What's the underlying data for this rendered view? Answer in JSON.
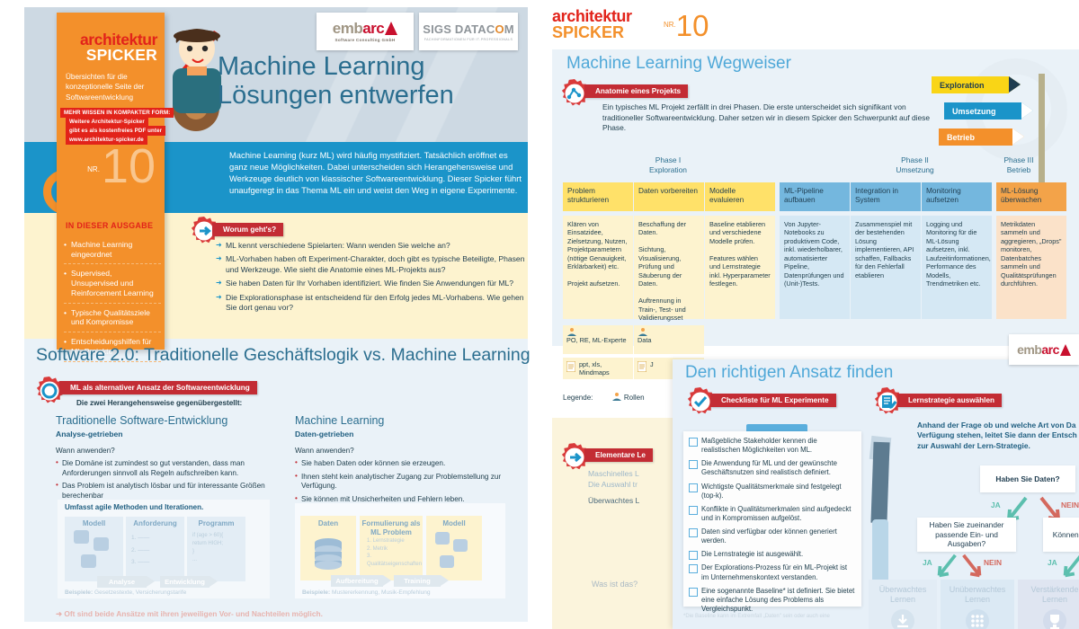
{
  "left_page": {
    "logos": [
      {
        "name": "embarc",
        "word_a": "emb",
        "word_b": "arc",
        "sub": "Software Consulting GmbH"
      },
      {
        "name": "sigs-datacom",
        "word": "SIGS DATAC",
        "word_o": "O",
        "word_end": "M",
        "sub": "FACHINFORMATIONEN FÜR IT-PROFESSIONALS"
      }
    ],
    "sidebar": {
      "brand_line1": "architektur",
      "brand_line2": "SPICKER",
      "tagline": "Übersichten für die konzeptionelle Seite der Softwareentwicklung",
      "red_bars": [
        "MEHR WISSEN IN KOMPAKTER FORM:",
        "Weitere Architektur-Spicker",
        "gibt es als kostenfreies PDF unter",
        "www.architektur-spicker.de"
      ],
      "nr_label": "NR.",
      "nr_value": "10",
      "issue_heading": "IN DIESER AUSGABE",
      "issue_items": [
        "Machine Learning eingeordnet",
        "Supervised, Unsupervised und Reinforcement Learning",
        "Typische Qualitätsziele und Kompromisse",
        "Entscheidungshilfen für ML-Projekte"
      ]
    },
    "title_line1": "Machine Learning",
    "title_line2": "Lösungen entwerfen",
    "intro": "Machine Learning (kurz ML) wird häufig mystifiziert. Tatsächlich eröffnet es ganz neue Möglichkeiten. Dabei unterscheiden sich Herangehensweise und Werkzeuge deutlich von klassischer Softwareentwicklung. Dieser Spicker führt unaufgeregt in das Thema ML ein und weist den Weg in eigene Experimente.",
    "worum": {
      "ribbon": "Worum geht's?",
      "items": [
        "ML kennt verschiedene Spielarten:  Wann wenden Sie welche an?",
        "ML-Vorhaben haben oft Experiment-Charakter, doch gibt es typische Beteiligte, Phasen und Werkzeuge. Wie sieht die Anatomie eines ML-Projekts aus?",
        "Sie haben Daten für Ihr Vorhaben identifiziert. Wie finden Sie Anwendungen für ML?",
        "Die Explorationsphase ist entscheidend für den Erfolg jedes ML-Vorhabens. Wie gehen Sie dort genau vor?"
      ]
    },
    "software20": {
      "section_title": "Software 2.0: Traditionelle Geschäftslogik vs. Machine Learning",
      "ribbon": "ML als alternativer Ansatz der Softwareentwicklung",
      "subtitle": "Die zwei Herangehensweise gegenübergestellt:",
      "left": {
        "heading": "Traditionelle Software-Entwicklung",
        "subheading": "Analyse-getrieben",
        "question": "Wann anwenden?",
        "bullets": [
          "Die Domäne ist zumindest so gut verstanden, dass man Anforderungen sinnvoll als Regeln aufschreiben kann.",
          "Das Problem ist analytisch lösbar und für interessante Größen berechenbar"
        ],
        "diagram_note": "Umfasst agile Methoden und Iterationen.",
        "cols": [
          "Modell",
          "Anforderung",
          "Programm"
        ],
        "req_items": [
          "1.",
          "2.",
          "3."
        ],
        "code_lines": [
          "if (age > 60){",
          "   return HIGH;",
          "}",
          "..."
        ],
        "arrows": [
          "Analyse",
          "Entwicklung"
        ],
        "examples_label": "Beispiele:",
        "examples": "Gesetzestexte, Versicherungstarife"
      },
      "right": {
        "heading": "Machine Learning",
        "subheading": "Daten-getrieben",
        "question": "Wann anwenden?",
        "bullets": [
          "Sie haben Daten oder können sie erzeugen.",
          "Ihnen steht kein analytischer Zugang zur Problemstellung zur Verfügung.",
          "Sie können mit Unsicherheiten und Fehlern leben."
        ],
        "cols": [
          "Daten",
          "Formulierung als ML Problem",
          "Modell"
        ],
        "formulation_items": [
          "1. Lernstrategie",
          "2. Metrik",
          "3. Qualitätseigenschaften"
        ],
        "arrows": [
          "Aufbereitung",
          "Training"
        ],
        "examples_label": "Beispiele:",
        "examples": "Mustererkennung, Musik-Empfehlung"
      },
      "footnote": "Oft sind beide Ansätze mit ihren jeweiligen Vor- und Nachteilen möglich."
    }
  },
  "right_page": {
    "brand_line1": "architektur",
    "brand_line2": "SPICKER",
    "nr_label": "NR.",
    "nr_value": "10",
    "wegweiser": {
      "panel_title": "Machine Learning Wegweiser",
      "ribbon": "Anatomie eines Projekts",
      "body": "Ein typisches ML Projekt zerfällt in drei Phasen. Die erste unterscheidet sich signifikant von traditioneller Softwareentwicklung. Daher setzen wir in diesem Spicker den Schwerpunkt auf diese Phase.",
      "signposts": [
        {
          "label": "Exploration",
          "color": "#f9d516",
          "text_color": "#1f3d50"
        },
        {
          "label": "Umsetzung",
          "color": "#1b94c9",
          "text_color": "#ffffff"
        },
        {
          "label": "Betrieb",
          "color": "#f3902b",
          "text_color": "#ffffff"
        }
      ],
      "phases": [
        {
          "num": "Phase I",
          "name": "Exploration"
        },
        {
          "num": "Phase II",
          "name": "Umsetzung"
        },
        {
          "num": "Phase III",
          "name": "Betrieb"
        }
      ],
      "columns": [
        {
          "head": "Problem strukturieren",
          "head_bg": "#ffe169",
          "body_bg": "#fdf3cf",
          "body": "Klären von Einsatzidee, Zielsetzung, Nutzen, Projektparametern (nötige Genauigkeit, Erklärbarkeit) etc.\n\nProjekt aufsetzen."
        },
        {
          "head": "Daten vorbereiten",
          "head_bg": "#ffe169",
          "body_bg": "#fdf3cf",
          "body": "Beschaffung der Daten.\n\nSichtung, Visualisierung, Prüfung und Säuberung der Daten.\n\nAuftrennung in Train-, Test- und Validierungsset"
        },
        {
          "head": "Modelle evaluieren",
          "head_bg": "#ffe169",
          "body_bg": "#fdf3cf",
          "body": "Baseline etablieren und verschiedene Modelle prüfen.\n\nFeatures wählen und Lernstrategie inkl. Hyperparameter festlegen."
        },
        {
          "head": "ML-Pipeline aufbauen",
          "head_bg": "#74b7de",
          "body_bg": "#d5e8f4",
          "body": "Von Jupyter-Notebooks zu produktivem Code, inkl. wiederholbarer, automatisierter Pipeline, Datenprüfungen und (Unit-)Tests."
        },
        {
          "head": "Integration in System",
          "head_bg": "#74b7de",
          "body_bg": "#d5e8f4",
          "body": "Zusammenspiel mit der bestehenden Lösung implementieren, API schaffen, Fallbacks für den Fehlerfall etablieren"
        },
        {
          "head": "Monitoring aufsetzen",
          "head_bg": "#74b7de",
          "body_bg": "#d5e8f4",
          "body": "Logging und Monitoring für die ML-Lösung aufsetzen, inkl. Laufzeitinformationen, Performance des Modells, Trendmetriken etc."
        },
        {
          "head": "ML-Lösung überwachen",
          "head_bg": "#f3a349",
          "body_bg": "#fbe2c9",
          "body": "Metrikdaten sammeln und aggregieren, „Drops\" monitoren, Datenbatches sammeln und Qualitätsprüfungen durchführen."
        }
      ],
      "roles": [
        {
          "icon": "role-icon",
          "text": "PO, RE, ML-Experte"
        },
        {
          "icon": "role-icon",
          "text": "Data"
        }
      ],
      "artifacts": [
        {
          "icon": "doc-icon",
          "text": "ppt, xls, Mindmaps"
        },
        {
          "icon": "doc-icon",
          "text": "J"
        }
      ],
      "legend_label": "Legende:",
      "legend_value": "Rollen"
    },
    "elementare": {
      "ribbon": "Elementare Le",
      "line1": "Maschinelles L",
      "line2": "Die Auswahl tr",
      "line3": "Überwachtes L",
      "footer": "Was ist das?"
    },
    "ansatz": {
      "panel_title": "Den richtigen Ansatz finden",
      "checklist": {
        "ribbon": "Checkliste für ML Experimente",
        "items": [
          "Maßgebliche Stakeholder kennen die realistischen Möglichkeiten von ML.",
          "Die Anwendung für ML und der gewünschte Geschäftsnutzen sind realistisch definiert.",
          "Wichtigste Qualitätsmerkmale sind festgelegt (top-k).",
          "Konflikte in Qualitätsmerkmalen sind aufgedeckt und in Kompromissen aufgelöst.",
          "Daten sind verfügbar oder können generiert werden.",
          "Die Lernstrategie ist ausgewählt.",
          "Der Explorations-Prozess für ein ML-Projekt ist im Unternehmenskontext verstanden.",
          "Eine sogenannte Baseline* ist definiert. Sie bietet eine einfache Lösung des Problems als Vergleichspunkt."
        ],
        "footnote": "*Die Baseline kann im Extremfall „Daten\" sein oder auch eine"
      },
      "lernstrategie": {
        "ribbon": "Lernstrategie auswählen",
        "body": "Anhand der Frage ob und welche Art von Da Verfügung stehen, leitet Sie dann der Entsch zur Auswahl der Lern-Strategie.",
        "tree": {
          "root": "Haben Sie Daten?",
          "branch_left": "Haben Sie zueinander passende Ein- und Ausgaben?",
          "branch_right": "Können Simulati mentie",
          "labels": {
            "yes": "JA",
            "no": "NEIN"
          },
          "leaves": [
            {
              "label": "Überwachtes Lernen",
              "icon": "download-icon"
            },
            {
              "label": "Unüberwachtes Lernen",
              "icon": "grid-icon"
            },
            {
              "label": "Verstärkende Lernen",
              "icon": "trophy-icon"
            }
          ]
        }
      },
      "logo": {
        "word_a": "emb",
        "word_b": "arc"
      }
    }
  },
  "colors": {
    "brand_red": "#e2231a",
    "ribbon_red": "#c32c34",
    "orange": "#f3902b",
    "blue": "#1b94c9",
    "teal_title": "#2b6e8f",
    "yellow": "#ffe169",
    "panel_bg": "#eaf2f8",
    "cream": "#fdf3cf"
  }
}
